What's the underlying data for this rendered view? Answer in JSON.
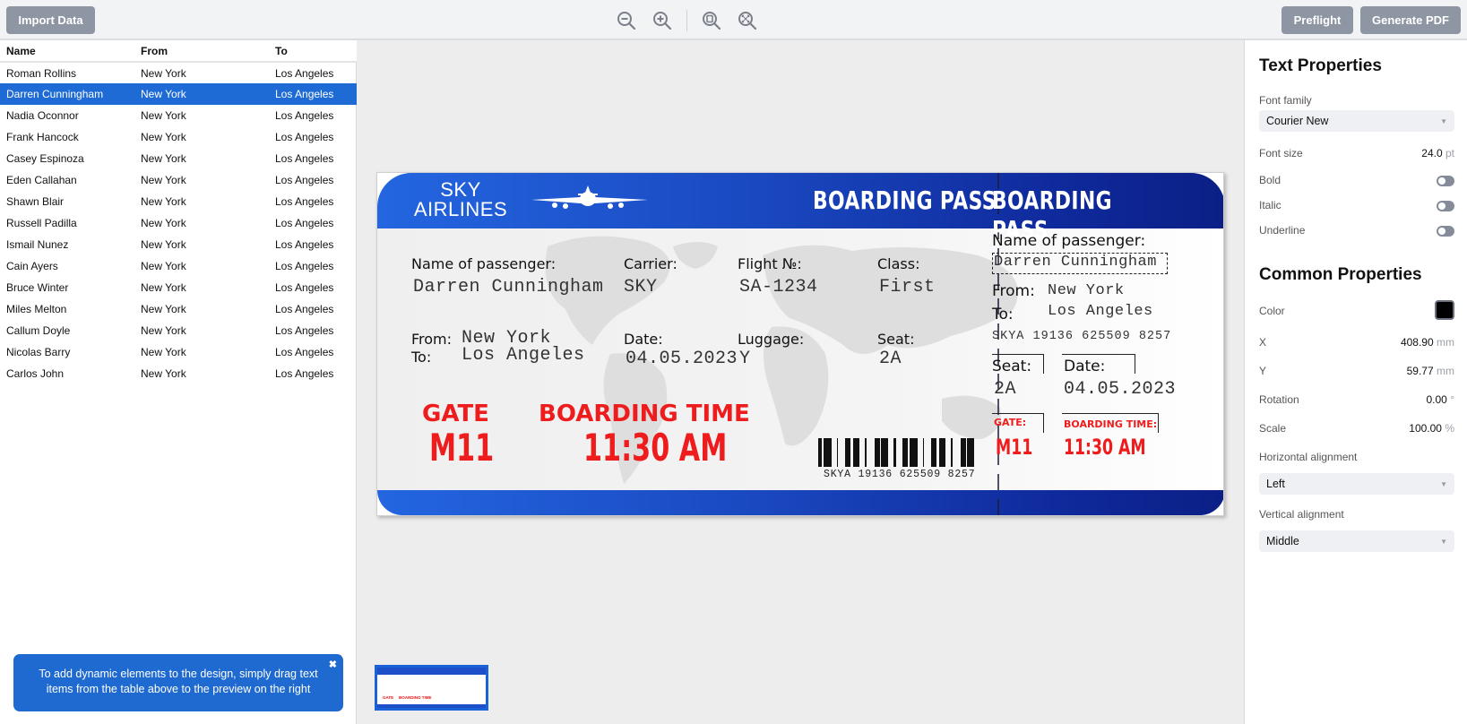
{
  "toolbar": {
    "import_label": "Import Data",
    "preflight_label": "Preflight",
    "generate_label": "Generate PDF",
    "zoom_tools": [
      "zoom-out-icon",
      "zoom-in-icon",
      "zoom-page-icon",
      "zoom-fit-icon"
    ]
  },
  "table": {
    "columns": [
      "Name",
      "From",
      "To"
    ],
    "selected_index": 1,
    "rows": [
      [
        "Roman Rollins",
        "New York",
        "Los Angeles"
      ],
      [
        "Darren Cunningham",
        "New York",
        "Los Angeles"
      ],
      [
        "Nadia Oconnor",
        "New York",
        "Los Angeles"
      ],
      [
        "Frank Hancock",
        "New York",
        "Los Angeles"
      ],
      [
        "Casey Espinoza",
        "New York",
        "Los Angeles"
      ],
      [
        "Eden Callahan",
        "New York",
        "Los Angeles"
      ],
      [
        "Shawn Blair",
        "New York",
        "Los Angeles"
      ],
      [
        "Russell Padilla",
        "New York",
        "Los Angeles"
      ],
      [
        "Ismail Nunez",
        "New York",
        "Los Angeles"
      ],
      [
        "Cain Ayers",
        "New York",
        "Los Angeles"
      ],
      [
        "Bruce Winter",
        "New York",
        "Los Angeles"
      ],
      [
        "Miles Melton",
        "New York",
        "Los Angeles"
      ],
      [
        "Callum Doyle",
        "New York",
        "Los Angeles"
      ],
      [
        "Nicolas Barry",
        "New York",
        "Los Angeles"
      ],
      [
        "Carlos John",
        "New York",
        "Los Angeles"
      ]
    ]
  },
  "hint": {
    "text": "To add dynamic elements to the design, simply drag text items from the table above to the preview on the right",
    "close_glyph": "✖"
  },
  "ticket": {
    "logo_line1": "SKY",
    "logo_line2": "AIRLINES",
    "title_main": "BOARDING PASS",
    "title_stub": "BOARDING PASS",
    "labels": {
      "passenger": "Name of passenger:",
      "carrier": "Carrier:",
      "flight": "Flight №:",
      "class": "Class:",
      "from": "From:",
      "to": "To:",
      "date": "Date:",
      "luggage": "Luggage:",
      "seat": "Seat:",
      "gate": "GATE",
      "boarding_time": "BOARDING TIME",
      "gate_stub": "GATE:",
      "boarding_time_stub": "BOARDING TIME:"
    },
    "values": {
      "passenger": "Darren Cunningham",
      "carrier": "SKY",
      "flight": "SA-1234",
      "class": "First",
      "from": "New York",
      "to": "Los Angeles",
      "date": "04.05.2023",
      "luggage": "Y",
      "seat": "2A",
      "gate": "M11",
      "boarding_time": "11:30 AM",
      "barcode_text": "SKYA 19136 625509 8257"
    },
    "colors": {
      "header_start": "#2366e0",
      "header_end": "#0b1f86",
      "accent_red": "#ee1c1c"
    }
  },
  "properties": {
    "text_title": "Text Properties",
    "font_family_label": "Font family",
    "font_family_value": "Courier New",
    "font_size_label": "Font size",
    "font_size_value": "24.0",
    "font_size_unit": "pt",
    "bold_label": "Bold",
    "bold": false,
    "italic_label": "Italic",
    "italic": false,
    "underline_label": "Underline",
    "underline": false,
    "common_title": "Common Properties",
    "color_label": "Color",
    "color_value": "#000000",
    "x_label": "X",
    "x_value": "408.90",
    "x_unit": "mm",
    "y_label": "Y",
    "y_value": "59.77",
    "y_unit": "mm",
    "rotation_label": "Rotation",
    "rotation_value": "0.00",
    "rotation_unit": "°",
    "scale_label": "Scale",
    "scale_value": "100.00",
    "scale_unit": "%",
    "halign_label": "Horizontal alignment",
    "halign_value": "Left",
    "valign_label": "Vertical alignment",
    "valign_value": "Middle"
  }
}
